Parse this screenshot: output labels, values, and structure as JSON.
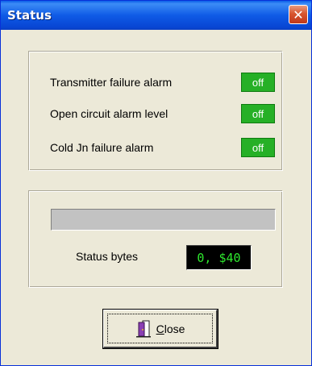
{
  "window": {
    "title": "Status",
    "close_glyph": "✕"
  },
  "alarms": [
    {
      "label": "Transmitter failure alarm",
      "state": "off",
      "color": "#26b026"
    },
    {
      "label": "Open circuit alarm level",
      "state": "off",
      "color": "#26b026"
    },
    {
      "label": "Cold Jn failure alarm",
      "state": "off",
      "color": "#26b026"
    }
  ],
  "status": {
    "progress_fraction": 0,
    "label": "Status bytes",
    "value": "0, $40",
    "value_color": "#2ee82e"
  },
  "close_button": {
    "accel": "C",
    "rest": "lose",
    "icon": "door-exit-icon"
  }
}
